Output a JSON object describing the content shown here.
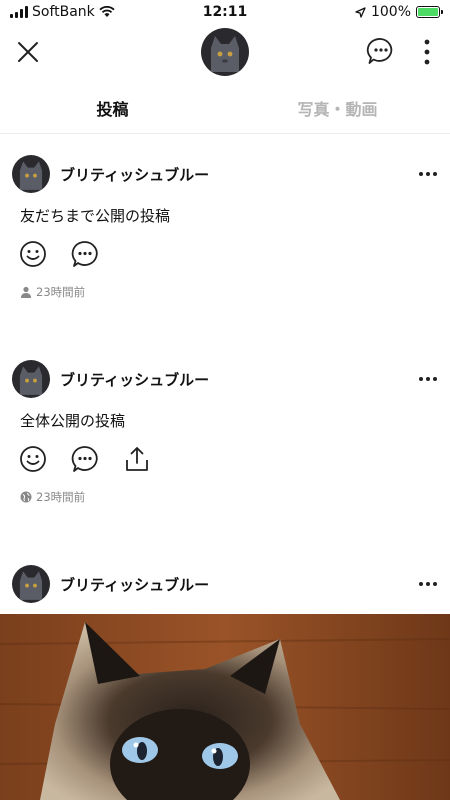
{
  "status_bar": {
    "carrier": "SoftBank",
    "time": "12:11",
    "battery": "100%",
    "battery_level": 1.0
  },
  "nav": {
    "close_icon": "close-icon",
    "chat_icon": "chat-bubble-icon",
    "more_icon": "vertical-more-icon"
  },
  "tabs": [
    {
      "label": "投稿",
      "active": true
    },
    {
      "label": "写真・動画",
      "active": false
    }
  ],
  "posts": [
    {
      "author": "ブリティッシュブルー",
      "text": "友だちまで公開の投稿",
      "visibility_icon": "person-icon",
      "timestamp": "23時間前",
      "actions": [
        "smile-icon",
        "comment-icon"
      ]
    },
    {
      "author": "ブリティッシュブルー",
      "text": "全体公開の投稿",
      "visibility_icon": "globe-icon",
      "timestamp": "23時間前",
      "actions": [
        "smile-icon",
        "comment-icon",
        "share-icon"
      ]
    },
    {
      "author": "ブリティッシュブルー",
      "image": "siamese-cat-photo"
    }
  ],
  "colors": {
    "text": "#111111",
    "muted": "#888888",
    "tab_inactive": "#b5b5b5",
    "battery": "#4cd964",
    "divider": "#ececec"
  }
}
